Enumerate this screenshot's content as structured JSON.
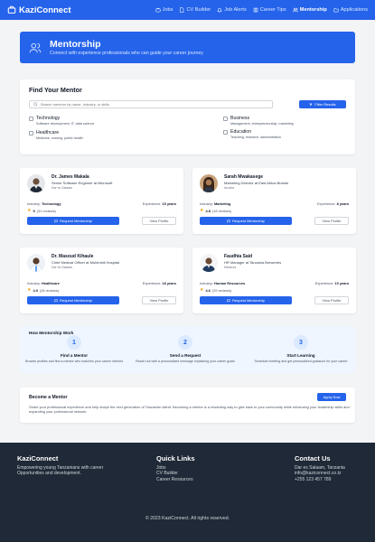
{
  "brand": {
    "name": "KaziConnect"
  },
  "nav": {
    "items": [
      {
        "label": "Jobs",
        "icon": "briefcase-icon"
      },
      {
        "label": "CV Builder",
        "icon": "file-icon"
      },
      {
        "label": "Job Alerts",
        "icon": "bell-icon"
      },
      {
        "label": "Career Tips",
        "icon": "book-icon"
      },
      {
        "label": "Mentorship",
        "icon": "users-icon",
        "active": true
      },
      {
        "label": "Applications",
        "icon": "folder-icon"
      }
    ]
  },
  "hero": {
    "title": "Mentorship",
    "subtitle": "Connect with experience professionals who can guide your career journey"
  },
  "search": {
    "title": "Find Your Mentor",
    "placeholder": "Search mentors by name, industry, or skills",
    "filter_label": "Filter Results",
    "categories": [
      {
        "name": "Technology",
        "desc": "Software development, IT, data science"
      },
      {
        "name": "Business",
        "desc": "Management, entrepreneurship, marketing"
      },
      {
        "name": "Healthcare",
        "desc": "Medicine, nursing, public health"
      },
      {
        "name": "Education",
        "desc": "Teaching, research, administration"
      }
    ]
  },
  "mentors": [
    {
      "name": "Dr. James Makala",
      "title": "Senior Software Engineer at Microsoft",
      "location": "Dar es Salaam",
      "industry_label": "Industry:",
      "industry": "Technology",
      "experience_label": "Experience:",
      "experience": "15 years",
      "rating": "5",
      "reviews": "(31 reviews)",
      "request_label": "Request Mentorship",
      "view_label": "View Profile"
    },
    {
      "name": "Sarah Mwakasege",
      "title": "Marketing Director at East Africa Brands",
      "location": "Arusha",
      "industry_label": "Industry:",
      "industry": "Marketing",
      "experience_label": "Experience:",
      "experience": "8 years",
      "rating": "4.8",
      "reviews": "(18 reviews)",
      "request_label": "Request Mentorship",
      "view_label": "View Profile"
    },
    {
      "name": "Dr. Masoud Kihaule",
      "title": "Chief Medical Officer at Muhimbili Hospital",
      "location": "Dar es Salaam",
      "industry_label": "Industry:",
      "industry": "Healthcare",
      "experience_label": "Experience:",
      "experience": "18 years",
      "rating": "4.9",
      "reviews": "(26 reviews)",
      "request_label": "Request Mentorship",
      "view_label": "View Profile"
    },
    {
      "name": "Faudhia Said",
      "title": "HR Manager at Tanzania Breweries",
      "location": "Mwanza",
      "industry_label": "Industry:",
      "industry": "Human Resources",
      "experience_label": "Experience:",
      "experience": "10 years",
      "rating": "4.6",
      "reviews": "(29 reviews)",
      "request_label": "Request Mentorship",
      "view_label": "View Profile"
    }
  ],
  "how": {
    "title": "How Mentorship Work",
    "steps": [
      {
        "num": "1",
        "title": "Find a Mentor",
        "desc": "Browse profiles and find a mentor who matches your career interest"
      },
      {
        "num": "2",
        "title": "Send a Request",
        "desc": "Reach out with a personalized message explaining your career goals"
      },
      {
        "num": "3",
        "title": "Start Learning",
        "desc": "Schedule meeting and get personalized guidance for your career"
      }
    ]
  },
  "become": {
    "title": "Become a Mentor",
    "apply_label": "Apply Now",
    "text": "Share your professional experience and help shape the next generation of Tanzanian talent. Becoming a mentor is a rewarding way to give back to your community while enhancing your leadership skills and expanding your professional network."
  },
  "footer": {
    "brand": "KaziConnect",
    "tagline": "Empowering young Tanzanians with career Opportunities and development.",
    "links_title": "Quick Links",
    "links": [
      "Jobs",
      "CV Builder",
      "Career Resources"
    ],
    "contact_title": "Contact Us",
    "address": "Dar es Salaam, Tanzania",
    "email": "info@kaziconnect.co.tz",
    "phone": "+255 123 457 789",
    "copyright": "© 2023 KaziConnect. All rights reserved."
  },
  "colors": {
    "primary": "#2563eb",
    "footer": "#1f2937",
    "star": "#f59e0b"
  }
}
